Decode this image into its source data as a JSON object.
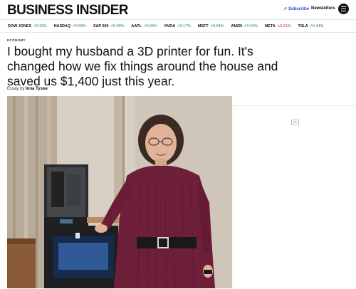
{
  "header": {
    "logo_text": "BUSINESS INSIDER",
    "subscribe_label": "Subscribe",
    "newsletters_label": "Newsletters"
  },
  "ticker": [
    {
      "symbol": "DOW JONES",
      "change": "0.32%",
      "direction": "up"
    },
    {
      "symbol": "NASDAQ",
      "change": "0.09%",
      "direction": "up"
    },
    {
      "symbol": "S&P 500",
      "change": "0.09%",
      "direction": "up"
    },
    {
      "symbol": "AAPL",
      "change": "0.04%",
      "direction": "up"
    },
    {
      "symbol": "NVDA",
      "change": "0.17%",
      "direction": "up"
    },
    {
      "symbol": "MSFT",
      "change": "0.04%",
      "direction": "up"
    },
    {
      "symbol": "AMZN",
      "change": "0.24%",
      "direction": "up"
    },
    {
      "symbol": "META",
      "change": "0.01%",
      "direction": "down"
    },
    {
      "symbol": "TSLA",
      "change": "0.44%",
      "direction": "up"
    }
  ],
  "article": {
    "section": "ECONOMY",
    "headline": "I bought my husband a 3D printer for fun. It's changed how we fix things around the house and saved us $1,400 just this year.",
    "byline_prefix": "Essay by",
    "author": "Inna Tysoe"
  },
  "ad": {
    "badge": "AD"
  },
  "colors": {
    "up": "#18875a",
    "down": "#d1253a",
    "brand_link": "#1a4fd6",
    "sweater": "#6e1f3a"
  }
}
